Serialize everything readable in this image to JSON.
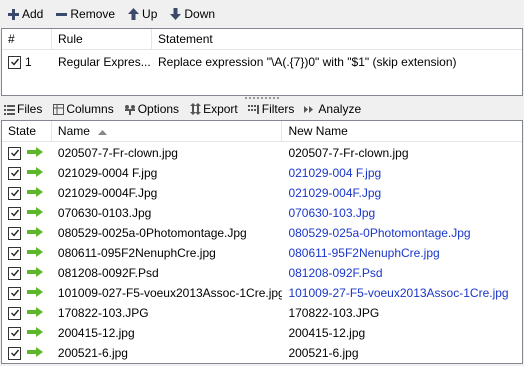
{
  "toolbar": {
    "add_label": "Add",
    "remove_label": "Remove",
    "up_label": "Up",
    "down_label": "Down"
  },
  "rules": {
    "columns": {
      "num": "#",
      "rule": "Rule",
      "statement": "Statement"
    },
    "rows": [
      {
        "num": "1",
        "rule": "Regular Expres...",
        "statement": "Replace expression \"\\A(.{7})0\" with \"$1\" (skip extension)",
        "checked": true
      }
    ]
  },
  "tabs": {
    "files": "Files",
    "columns": "Columns",
    "options": "Options",
    "export": "Export",
    "filters": "Filters",
    "analyze": "Analyze"
  },
  "files": {
    "columns": {
      "state": "State",
      "name": "Name",
      "new_name": "New Name"
    },
    "rows": [
      {
        "name": "020507-7-Fr-clown.jpg",
        "new_name": "020507-7-Fr-clown.jpg",
        "changed": false
      },
      {
        "name": "021029-0004  F.jpg",
        "new_name": "021029-004  F.jpg",
        "changed": true
      },
      {
        "name": "021029-0004F.Jpg",
        "new_name": "021029-004F.Jpg",
        "changed": true
      },
      {
        "name": "070630-0103.Jpg",
        "new_name": "070630-103.Jpg",
        "changed": true
      },
      {
        "name": "080529-0025a-0Photomontage.Jpg",
        "new_name": "080529-025a-0Photomontage.Jpg",
        "changed": true
      },
      {
        "name": "080611-095F2NenuphCre.jpg",
        "new_name": "080611-95F2NenuphCre.jpg",
        "changed": true
      },
      {
        "name": "081208-0092F.Psd",
        "new_name": "081208-092F.Psd",
        "changed": true
      },
      {
        "name": "101009-027-F5-voeux2013Assoc-1Cre.jpg",
        "new_name": "101009-27-F5-voeux2013Assoc-1Cre.jpg",
        "changed": true
      },
      {
        "name": "170822-103.JPG",
        "new_name": "170822-103.JPG",
        "changed": false
      },
      {
        "name": "200415-12.jpg",
        "new_name": "200415-12.jpg",
        "changed": false
      },
      {
        "name": "200521-6.jpg",
        "new_name": "200521-6.jpg",
        "changed": false
      }
    ]
  },
  "colors": {
    "changed_text": "#1a36c8",
    "arrow_green": "#5cb82a"
  }
}
